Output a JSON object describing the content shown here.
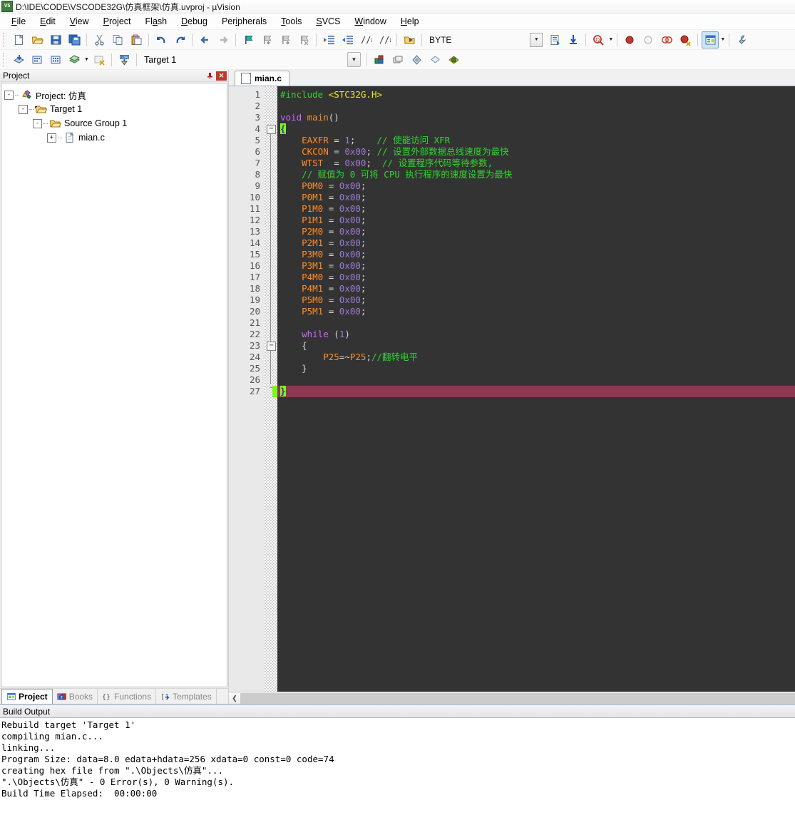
{
  "window": {
    "title": "D:\\IDE\\CODE\\VSCODE32G\\仿真框架\\仿真.uvproj - µVision",
    "app_icon": "uvision-icon"
  },
  "menu": {
    "items": [
      {
        "label": "File",
        "accel": "F"
      },
      {
        "label": "Edit",
        "accel": "E"
      },
      {
        "label": "View",
        "accel": "V"
      },
      {
        "label": "Project",
        "accel": "P"
      },
      {
        "label": "Flash",
        "accel": "a"
      },
      {
        "label": "Debug",
        "accel": "D"
      },
      {
        "label": "Peripherals",
        "accel": "i"
      },
      {
        "label": "Tools",
        "accel": "T"
      },
      {
        "label": "SVCS",
        "accel": "S"
      },
      {
        "label": "Window",
        "accel": "W"
      },
      {
        "label": "Help",
        "accel": "H"
      }
    ]
  },
  "toolbar_main": {
    "buttons": [
      {
        "name": "new-file-icon",
        "tip": "New"
      },
      {
        "name": "open-file-icon",
        "tip": "Open"
      },
      {
        "name": "save-icon",
        "tip": "Save"
      },
      {
        "name": "save-all-icon",
        "tip": "Save All"
      },
      {
        "name": "cut-icon",
        "tip": "Cut"
      },
      {
        "name": "copy-icon",
        "tip": "Copy"
      },
      {
        "name": "paste-icon",
        "tip": "Paste"
      },
      {
        "name": "undo-icon",
        "tip": "Undo"
      },
      {
        "name": "redo-icon",
        "tip": "Redo"
      },
      {
        "name": "navigate-back-icon",
        "tip": "Back"
      },
      {
        "name": "navigate-forward-icon",
        "tip": "Forward"
      },
      {
        "name": "bookmark-toggle-icon",
        "tip": "Insert/Remove Bookmark"
      },
      {
        "name": "bookmark-prev-icon",
        "tip": "Go to Previous Bookmark"
      },
      {
        "name": "bookmark-next-icon",
        "tip": "Go to Next Bookmark"
      },
      {
        "name": "bookmark-clear-icon",
        "tip": "Clear All Bookmarks"
      },
      {
        "name": "indent-right-icon",
        "tip": "Indent Selection"
      },
      {
        "name": "indent-left-icon",
        "tip": "Unindent Selection"
      },
      {
        "name": "comment-icon",
        "tip": "Comment Selection"
      },
      {
        "name": "uncomment-icon",
        "tip": "Uncomment Selection"
      },
      {
        "name": "hex-mode-icon",
        "tip": "Hex Mode"
      }
    ],
    "memory_type": "BYTE",
    "right_buttons": [
      {
        "name": "bookmark-list-icon",
        "tip": "Bookmarks"
      },
      {
        "name": "find-in-files-icon",
        "tip": "Find in Files"
      },
      {
        "name": "magnify-search-icon",
        "tip": "Find"
      },
      {
        "name": "breakpoint-insert-icon",
        "tip": "Insert/Remove Breakpoint"
      },
      {
        "name": "breakpoint-disable-icon",
        "tip": "Enable/Disable Breakpoint"
      },
      {
        "name": "breakpoint-disable-all-icon",
        "tip": "Disable All Breakpoints"
      },
      {
        "name": "breakpoint-kill-all-icon",
        "tip": "Kill All Breakpoints"
      },
      {
        "name": "window-manager-icon",
        "tip": "Manage Windows"
      },
      {
        "name": "configure-icon",
        "tip": "Configuration Wizard"
      }
    ]
  },
  "toolbar_build": {
    "buttons": [
      {
        "name": "translate-icon",
        "tip": "Translate Current File"
      },
      {
        "name": "build-icon",
        "tip": "Build"
      },
      {
        "name": "rebuild-icon",
        "tip": "Rebuild All Target Files"
      },
      {
        "name": "batch-build-icon",
        "tip": "Batch Build"
      },
      {
        "name": "stop-build-icon",
        "tip": "Stop Build"
      },
      {
        "name": "download-icon",
        "tip": "Download",
        "label": "LOAD"
      }
    ],
    "target_value": "Target 1",
    "target_buttons": [
      {
        "name": "target-options-icon",
        "tip": "Options for Target"
      },
      {
        "name": "manage-project-items-icon",
        "tip": "Manage Project Items"
      },
      {
        "name": "components-icon",
        "tip": "Manage Run-Time Environment"
      },
      {
        "name": "multi-project-icon",
        "tip": "Select Project"
      },
      {
        "name": "pack-installer-icon",
        "tip": "Pack Installer"
      }
    ]
  },
  "project_pane": {
    "title": "Project",
    "pin_icon": "pin-icon",
    "close_icon": "close-icon",
    "tree": [
      {
        "label": "Project: 仿真",
        "icon": "project-icon",
        "expander": "-",
        "depth": 0
      },
      {
        "label": "Target 1",
        "icon": "target-icon",
        "expander": "-",
        "depth": 1
      },
      {
        "label": "Source Group 1",
        "icon": "folder-icon",
        "expander": "-",
        "depth": 2
      },
      {
        "label": "mian.c",
        "icon": "c-file-icon",
        "expander": "+",
        "depth": 3
      }
    ],
    "tabs": [
      {
        "label": "Project",
        "icon": "project-tab-icon",
        "selected": true
      },
      {
        "label": "Books",
        "icon": "books-tab-icon",
        "selected": false
      },
      {
        "label": "Functions",
        "icon": "functions-tab-icon",
        "selected": false
      },
      {
        "label": "Templates",
        "icon": "templates-tab-icon",
        "selected": false
      }
    ]
  },
  "editor": {
    "tabs": [
      {
        "label": "mian.c",
        "icon": "c-file-icon",
        "active": true
      }
    ],
    "current_line": 27,
    "fold_markers": [
      4,
      23
    ],
    "line_numbers": [
      1,
      2,
      3,
      4,
      5,
      6,
      7,
      8,
      9,
      10,
      11,
      12,
      13,
      14,
      15,
      16,
      17,
      18,
      19,
      20,
      21,
      22,
      23,
      24,
      25,
      26,
      27
    ],
    "hscroll_left_icon": "scroll-left-arrow-icon",
    "lines": [
      {
        "n": 1,
        "tokens": [
          {
            "t": "#include ",
            "c": "tk-pp"
          },
          {
            "t": "<STC32G.H>",
            "c": "tk-str"
          }
        ]
      },
      {
        "n": 2,
        "tokens": []
      },
      {
        "n": 3,
        "tokens": [
          {
            "t": "void ",
            "c": "tk-kw"
          },
          {
            "t": "main",
            "c": "tk-fn"
          },
          {
            "t": "()",
            "c": "tk-op"
          }
        ]
      },
      {
        "n": 4,
        "tokens": [
          {
            "t": "{",
            "c": "brace-hl"
          }
        ]
      },
      {
        "n": 5,
        "tokens": [
          {
            "t": "    ",
            "c": "tk-plain"
          },
          {
            "t": "EAXFR",
            "c": "tk-id"
          },
          {
            "t": " = ",
            "c": "tk-op"
          },
          {
            "t": "1",
            "c": "tk-num"
          },
          {
            "t": ";",
            "c": "tk-op"
          },
          {
            "t": "    ",
            "c": "tk-plain"
          },
          {
            "t": "// 使能访问 XFR",
            "c": "tk-cmt"
          }
        ]
      },
      {
        "n": 6,
        "tokens": [
          {
            "t": "    ",
            "c": "tk-plain"
          },
          {
            "t": "CKCON",
            "c": "tk-id"
          },
          {
            "t": " = ",
            "c": "tk-op"
          },
          {
            "t": "0x00",
            "c": "tk-num"
          },
          {
            "t": "; ",
            "c": "tk-op"
          },
          {
            "t": "// 设置外部数据总线速度为最快",
            "c": "tk-cmt"
          }
        ]
      },
      {
        "n": 7,
        "tokens": [
          {
            "t": "    ",
            "c": "tk-plain"
          },
          {
            "t": "WTST",
            "c": "tk-id"
          },
          {
            "t": "  = ",
            "c": "tk-op"
          },
          {
            "t": "0x00",
            "c": "tk-num"
          },
          {
            "t": ";  ",
            "c": "tk-op"
          },
          {
            "t": "// 设置程序代码等待参数,",
            "c": "tk-cmt"
          }
        ]
      },
      {
        "n": 8,
        "tokens": [
          {
            "t": "    ",
            "c": "tk-plain"
          },
          {
            "t": "// 赋值为 0 可将 CPU 执行程序的速度设置为最快",
            "c": "tk-cmt"
          }
        ]
      },
      {
        "n": 9,
        "tokens": [
          {
            "t": "    ",
            "c": "tk-plain"
          },
          {
            "t": "P0M0",
            "c": "tk-id"
          },
          {
            "t": " = ",
            "c": "tk-op"
          },
          {
            "t": "0x00",
            "c": "tk-num"
          },
          {
            "t": ";",
            "c": "tk-op"
          }
        ]
      },
      {
        "n": 10,
        "tokens": [
          {
            "t": "    ",
            "c": "tk-plain"
          },
          {
            "t": "P0M1",
            "c": "tk-id"
          },
          {
            "t": " = ",
            "c": "tk-op"
          },
          {
            "t": "0x00",
            "c": "tk-num"
          },
          {
            "t": ";",
            "c": "tk-op"
          }
        ]
      },
      {
        "n": 11,
        "tokens": [
          {
            "t": "    ",
            "c": "tk-plain"
          },
          {
            "t": "P1M0",
            "c": "tk-id"
          },
          {
            "t": " = ",
            "c": "tk-op"
          },
          {
            "t": "0x00",
            "c": "tk-num"
          },
          {
            "t": ";",
            "c": "tk-op"
          }
        ]
      },
      {
        "n": 12,
        "tokens": [
          {
            "t": "    ",
            "c": "tk-plain"
          },
          {
            "t": "P1M1",
            "c": "tk-id"
          },
          {
            "t": " = ",
            "c": "tk-op"
          },
          {
            "t": "0x00",
            "c": "tk-num"
          },
          {
            "t": ";",
            "c": "tk-op"
          }
        ]
      },
      {
        "n": 13,
        "tokens": [
          {
            "t": "    ",
            "c": "tk-plain"
          },
          {
            "t": "P2M0",
            "c": "tk-id"
          },
          {
            "t": " = ",
            "c": "tk-op"
          },
          {
            "t": "0x00",
            "c": "tk-num"
          },
          {
            "t": ";",
            "c": "tk-op"
          }
        ]
      },
      {
        "n": 14,
        "tokens": [
          {
            "t": "    ",
            "c": "tk-plain"
          },
          {
            "t": "P2M1",
            "c": "tk-id"
          },
          {
            "t": " = ",
            "c": "tk-op"
          },
          {
            "t": "0x00",
            "c": "tk-num"
          },
          {
            "t": ";",
            "c": "tk-op"
          }
        ]
      },
      {
        "n": 15,
        "tokens": [
          {
            "t": "    ",
            "c": "tk-plain"
          },
          {
            "t": "P3M0",
            "c": "tk-id"
          },
          {
            "t": " = ",
            "c": "tk-op"
          },
          {
            "t": "0x00",
            "c": "tk-num"
          },
          {
            "t": ";",
            "c": "tk-op"
          }
        ]
      },
      {
        "n": 16,
        "tokens": [
          {
            "t": "    ",
            "c": "tk-plain"
          },
          {
            "t": "P3M1",
            "c": "tk-id"
          },
          {
            "t": " = ",
            "c": "tk-op"
          },
          {
            "t": "0x00",
            "c": "tk-num"
          },
          {
            "t": ";",
            "c": "tk-op"
          }
        ]
      },
      {
        "n": 17,
        "tokens": [
          {
            "t": "    ",
            "c": "tk-plain"
          },
          {
            "t": "P4M0",
            "c": "tk-id"
          },
          {
            "t": " = ",
            "c": "tk-op"
          },
          {
            "t": "0x00",
            "c": "tk-num"
          },
          {
            "t": ";",
            "c": "tk-op"
          }
        ]
      },
      {
        "n": 18,
        "tokens": [
          {
            "t": "    ",
            "c": "tk-plain"
          },
          {
            "t": "P4M1",
            "c": "tk-id"
          },
          {
            "t": " = ",
            "c": "tk-op"
          },
          {
            "t": "0x00",
            "c": "tk-num"
          },
          {
            "t": ";",
            "c": "tk-op"
          }
        ]
      },
      {
        "n": 19,
        "tokens": [
          {
            "t": "    ",
            "c": "tk-plain"
          },
          {
            "t": "P5M0",
            "c": "tk-id"
          },
          {
            "t": " = ",
            "c": "tk-op"
          },
          {
            "t": "0x00",
            "c": "tk-num"
          },
          {
            "t": ";",
            "c": "tk-op"
          }
        ]
      },
      {
        "n": 20,
        "tokens": [
          {
            "t": "    ",
            "c": "tk-plain"
          },
          {
            "t": "P5M1",
            "c": "tk-id"
          },
          {
            "t": " = ",
            "c": "tk-op"
          },
          {
            "t": "0x00",
            "c": "tk-num"
          },
          {
            "t": ";",
            "c": "tk-op"
          }
        ]
      },
      {
        "n": 21,
        "tokens": []
      },
      {
        "n": 22,
        "tokens": [
          {
            "t": "    ",
            "c": "tk-plain"
          },
          {
            "t": "while",
            "c": "tk-kw"
          },
          {
            "t": " ",
            "c": "tk-op"
          },
          {
            "t": "(",
            "c": "tk-op"
          },
          {
            "t": "1",
            "c": "tk-num"
          },
          {
            "t": ")",
            "c": "tk-op"
          }
        ]
      },
      {
        "n": 23,
        "tokens": [
          {
            "t": "    {",
            "c": "tk-op"
          }
        ]
      },
      {
        "n": 24,
        "tokens": [
          {
            "t": "        ",
            "c": "tk-plain"
          },
          {
            "t": "P25",
            "c": "tk-id"
          },
          {
            "t": "=~",
            "c": "tk-op"
          },
          {
            "t": "P25",
            "c": "tk-id"
          },
          {
            "t": ";",
            "c": "tk-op"
          },
          {
            "t": "//翻转电平",
            "c": "tk-cmt"
          }
        ]
      },
      {
        "n": 25,
        "tokens": [
          {
            "t": "    }",
            "c": "tk-op"
          }
        ]
      },
      {
        "n": 26,
        "tokens": []
      },
      {
        "n": 27,
        "tokens": [
          {
            "t": "}",
            "c": "brace-hl"
          }
        ],
        "current": true
      }
    ]
  },
  "build_output": {
    "title": "Build Output",
    "lines": [
      "Rebuild target 'Target 1'",
      "compiling mian.c...",
      "linking...",
      "Program Size: data=8.0 edata+hdata=256 xdata=0 const=0 code=74",
      "creating hex file from \".\\Objects\\仿真\"...",
      "\".\\Objects\\仿真\" - 0 Error(s), 0 Warning(s).",
      "Build Time Elapsed:  00:00:00"
    ]
  },
  "colors": {
    "editor_bg": "#333333",
    "current_line": "#8b3a52",
    "brace_match": "#7bf71f",
    "comment": "#2fd62f",
    "keyword": "#cc66ff",
    "identifier": "#ff8c28",
    "number": "#9a7bd6",
    "string": "#e8e82a"
  }
}
